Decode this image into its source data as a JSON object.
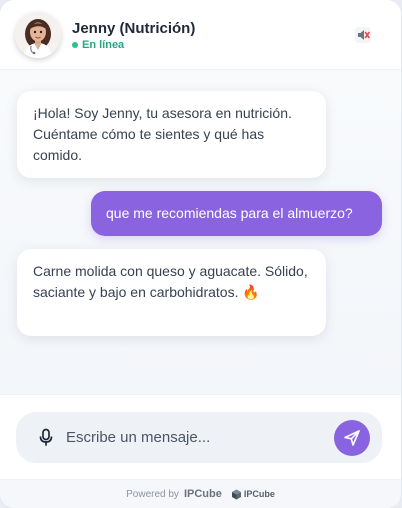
{
  "header": {
    "agent_name": "Jenny (Nutrición)",
    "status_text": "En línea",
    "status_color": "#22a884",
    "mute_icon": "speaker-muted-icon",
    "avatar_icon": "assistant-avatar-icon"
  },
  "messages": [
    {
      "sender": "bot",
      "text": "¡Hola! Soy Jenny, tu asesora en nutrición. Cuéntame cómo te sientes y qué has comido."
    },
    {
      "sender": "user",
      "text": "que me recomiendas para el almuerzo?"
    },
    {
      "sender": "bot",
      "text": "Carne molida con queso y aguacate. Sólido, saciante y bajo en carbohidratos. 🔥"
    }
  ],
  "composer": {
    "placeholder": "Escribe un mensaje...",
    "value": "",
    "mic_icon": "microphone-icon",
    "send_icon": "send-icon"
  },
  "footer": {
    "powered_by": "Powered by",
    "brand": "IPCube",
    "logo_text": "IPCube"
  },
  "colors": {
    "accent": "#8a63e0",
    "user_bubble_text": "#ffffff",
    "bot_bubble": "#ffffff"
  }
}
